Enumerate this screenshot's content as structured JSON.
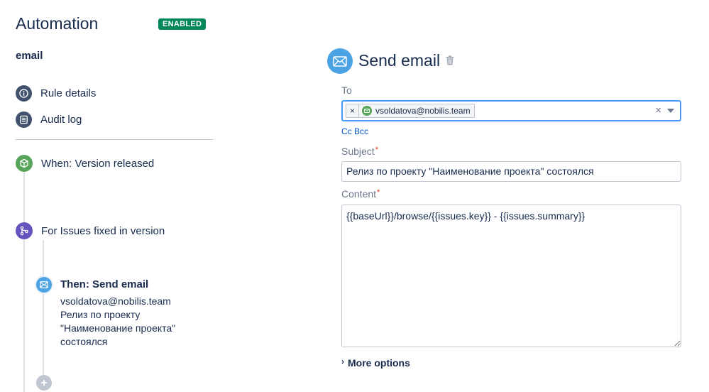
{
  "header": {
    "title": "Automation",
    "status": "ENABLED"
  },
  "rule": {
    "name": "email"
  },
  "nav": {
    "items": [
      {
        "label": "Rule details",
        "icon": "info-icon"
      },
      {
        "label": "Audit log",
        "icon": "list-icon"
      }
    ]
  },
  "flow": {
    "trigger_label": "When: Version released",
    "branch_label": "For Issues fixed in version",
    "action": {
      "title": "Then: Send email",
      "lines": [
        "vsoldatova@nobilis.team",
        "Релиз по проекту",
        "\"Наименование проекта\"",
        "состоялся"
      ]
    }
  },
  "panel": {
    "title": "Send email",
    "to": {
      "label": "To",
      "recipient": "vsoldatova@nobilis.team",
      "remove_glyph": "×",
      "clear_glyph": "×"
    },
    "cc_bcc": "Cc Bcc",
    "subject": {
      "label": "Subject",
      "required": "*",
      "value": "Релиз по проекту \"Наименование проекта\" состоялся"
    },
    "content": {
      "label": "Content",
      "required": "*",
      "value": "{{baseUrl}}/browse/{{issues.key}} - {{issues.summary}}"
    },
    "more_options": {
      "label": "More options",
      "chevron": "›"
    }
  },
  "colors": {
    "enabled_badge": "#00875a",
    "trigger_green": "#57a55a",
    "branch_purple": "#6554c0",
    "action_blue": "#4ba3e3",
    "focus_border": "#4c9aff",
    "link_blue": "#0052cc"
  }
}
